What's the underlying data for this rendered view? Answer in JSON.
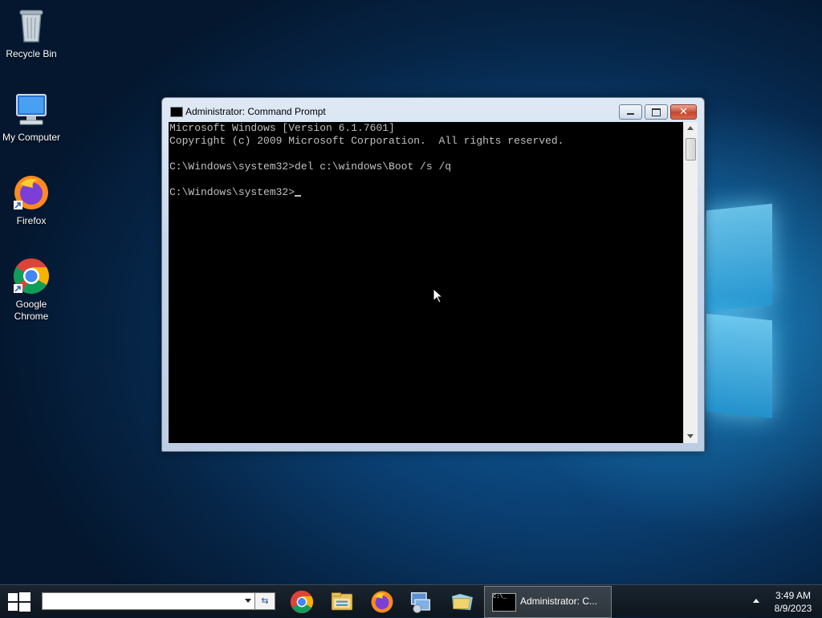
{
  "desktop": {
    "icons": [
      {
        "label": "Recycle Bin",
        "icon": "recycle-bin-icon"
      },
      {
        "label": "My Computer",
        "icon": "computer-icon"
      },
      {
        "label": "Firefox",
        "icon": "firefox-icon"
      },
      {
        "label": "Google Chrome",
        "icon": "chrome-icon"
      }
    ]
  },
  "window": {
    "title": "Administrator:  Command Prompt",
    "console_lines": [
      "Microsoft Windows [Version 6.1.7601]",
      "Copyright (c) 2009 Microsoft Corporation.  All rights reserved.",
      "",
      "C:\\Windows\\system32>del c:\\windows\\Boot /s /q",
      "",
      "C:\\Windows\\system32>"
    ]
  },
  "taskbar": {
    "search_value": "",
    "pinned": [
      "chrome-icon",
      "file-explorer-icon",
      "firefox-icon",
      "network-icon",
      "folder-icon"
    ],
    "active_task_label": "Administrator:  C...",
    "active_task_thumb": "C:\\_",
    "clock_time": "3:49 AM",
    "clock_date": "8/9/2023"
  },
  "colors": {
    "console_bg": "#000000",
    "console_text": "#c0c0c0",
    "close_button": "#c7462b"
  }
}
